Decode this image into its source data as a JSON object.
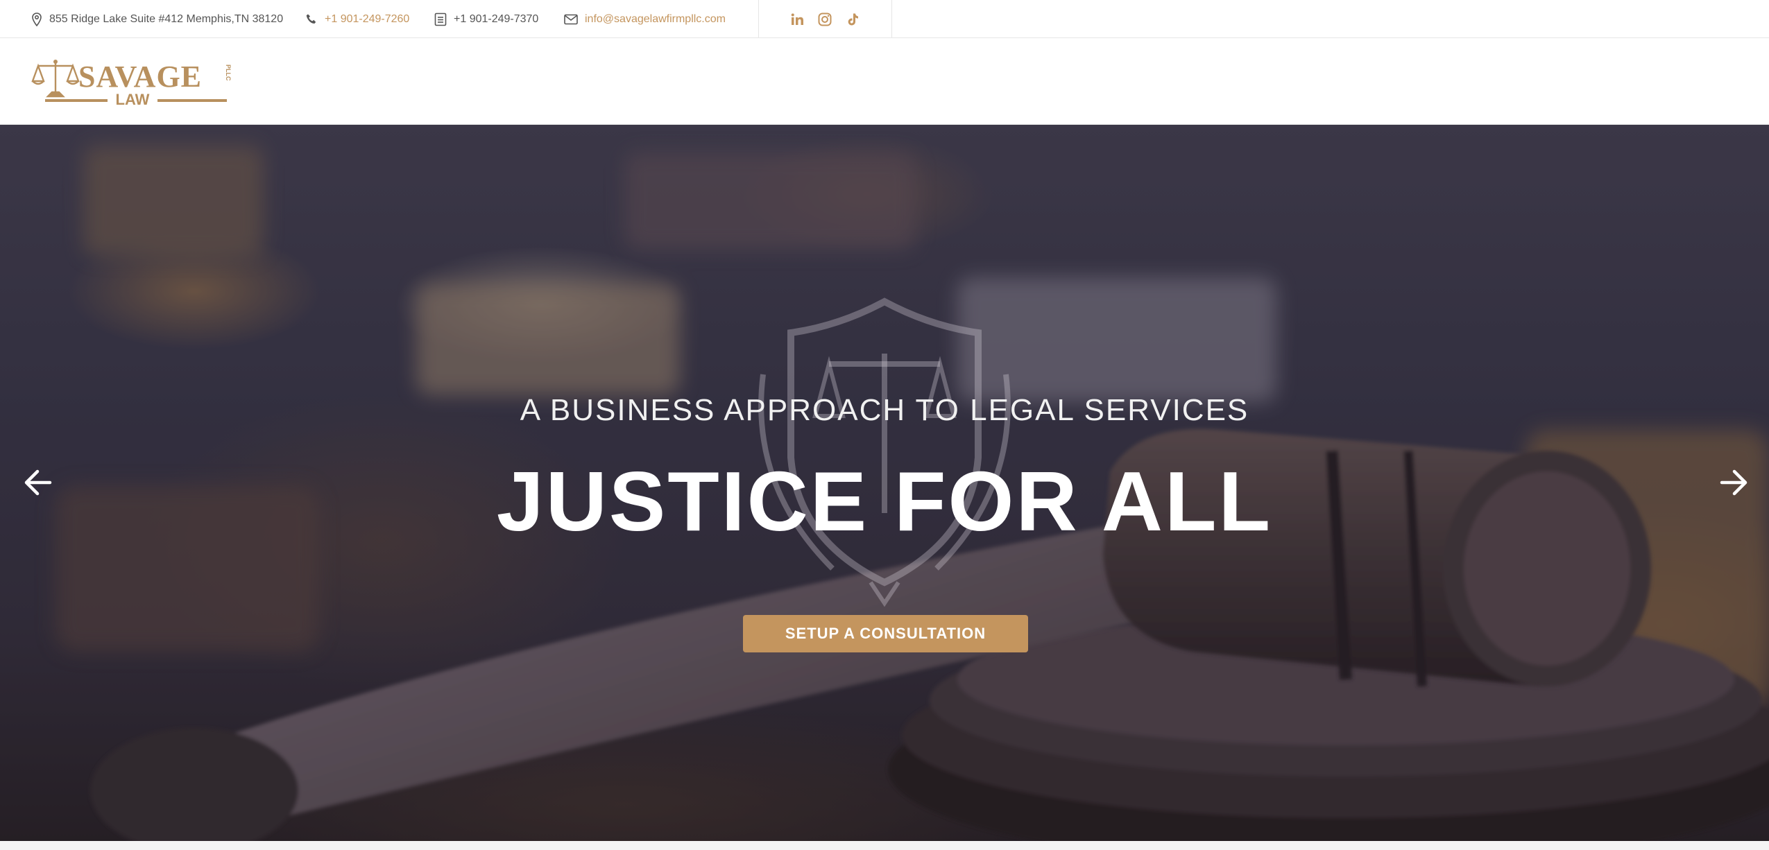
{
  "topbar": {
    "address": "855 Ridge Lake Suite #412 Memphis,TN 38120",
    "phone": "+1 901-249-7260",
    "fax": "+1 901-249-7370",
    "email": "info@savagelawfirmpllc.com",
    "social_icons": [
      "linkedin-icon",
      "instagram-icon",
      "tiktok-icon"
    ]
  },
  "logo": {
    "name": "SAVAGE",
    "sub": "LAW",
    "suffix": "PLLC"
  },
  "hero": {
    "subtitle": "A BUSINESS APPROACH TO LEGAL SERVICES",
    "title": "JUSTICE FOR ALL",
    "cta_label": "SETUP A CONSULTATION"
  },
  "colors": {
    "accent": "#c4955e",
    "text_muted": "#555555",
    "hero_text": "#ffffff"
  }
}
